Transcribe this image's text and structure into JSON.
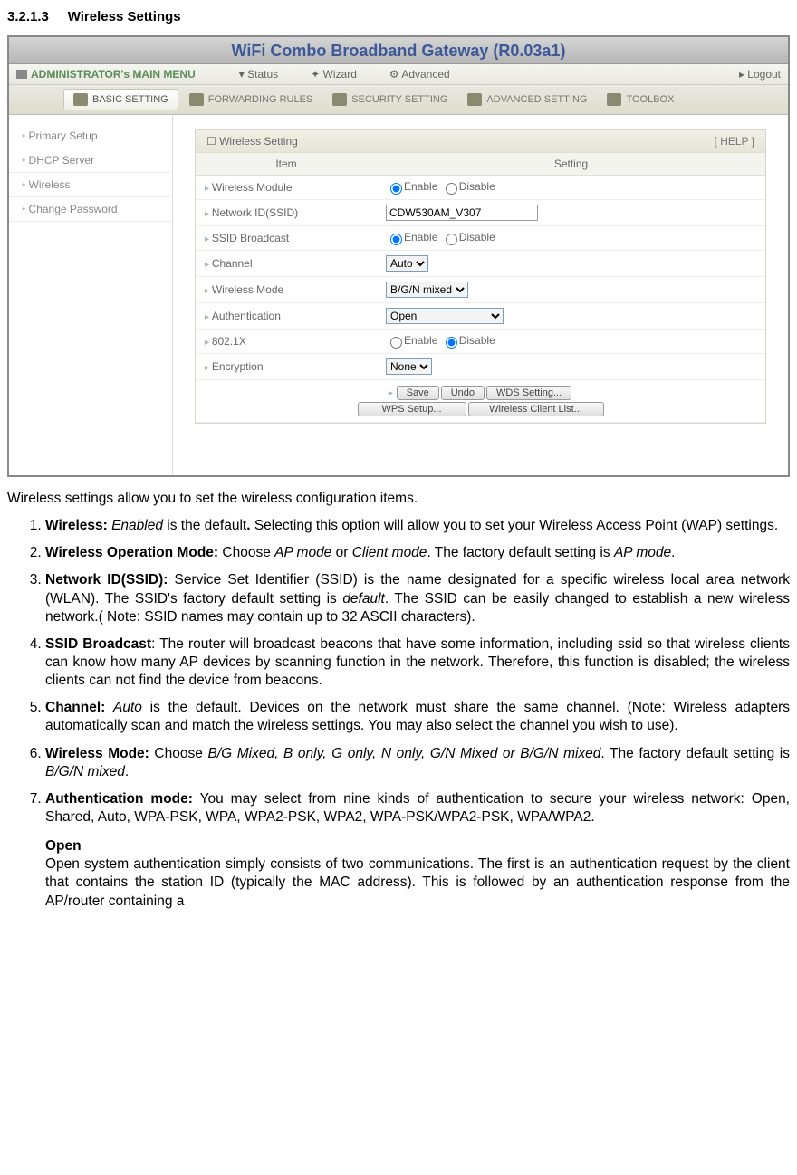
{
  "section_number": "3.2.1.3",
  "section_title": "Wireless Settings",
  "app": {
    "title": "WiFi Combo Broadband Gateway (R0.03a1)",
    "admin_label": "ADMINISTRATOR's MAIN MENU",
    "menu": {
      "status": "Status",
      "wizard": "Wizard",
      "advanced": "Advanced",
      "logout": "Logout"
    },
    "tabs": {
      "basic": "BASIC SETTING",
      "forwarding": "FORWARDING RULES",
      "security": "SECURITY SETTING",
      "advanced": "ADVANCED SETTING",
      "toolbox": "TOOLBOX"
    },
    "sidebar": {
      "primary": "Primary Setup",
      "dhcp": "DHCP Server",
      "wireless": "Wireless",
      "password": "Change Password"
    },
    "panel": {
      "title": "Wireless Setting",
      "help": "[ HELP ]",
      "col_item": "Item",
      "col_setting": "Setting",
      "rows": {
        "wmod": "Wireless Module",
        "ssid": "Network ID(SSID)",
        "bcast": "SSID Broadcast",
        "channel": "Channel",
        "wmode": "Wireless Mode",
        "auth": "Authentication",
        "dot1x": "802.1X",
        "enc": "Encryption"
      },
      "values": {
        "ssid": "CDW530AM_V307",
        "channel": "Auto",
        "wmode": "B/G/N mixed",
        "auth": "Open",
        "enc": "None",
        "enable": "Enable",
        "disable": "Disable"
      },
      "buttons": {
        "save": "Save",
        "undo": "Undo",
        "wds": "WDS Setting...",
        "wps": "WPS Setup...",
        "clients": "Wireless Client List..."
      }
    }
  },
  "doc": {
    "intro": "Wireless settings allow you to set the wireless configuration items.",
    "items": {
      "i1a": "Wireless:",
      "i1b": "Enabled",
      "i1c": " is the ",
      "i1d": "default",
      "i1e": ". ",
      "i1f": "Selecting this option will allow you to set your Wireless Access Point (WAP) settings.",
      "i2a": "Wireless Operation Mode:",
      "i2b": " Choose ",
      "i2c": "AP mode",
      "i2d": " or ",
      "i2e": "Client mode",
      "i2f": ". The factory default setting is ",
      "i2g": "AP mode",
      "i2h": ".",
      "i3a": "Network ID(SSID):",
      "i3b": " Service Set Identifier (SSID) is the name designated for a specific wireless local area network (WLAN). The SSID's factory default setting is ",
      "i3c": "default",
      "i3d": ". The SSID can be easily changed to establish a new wireless network.( Note: SSID names may contain up to 32 ASCII characters).",
      "i4a": "SSID Broadcast",
      "i4b": ": The router will broadcast beacons that have some information, including ssid so that wireless clients can know how many AP devices by scanning function in the network. Therefore, this function is disabled; the wireless clients can not find the device from beacons.",
      "i5a": "Channel:",
      "i5b": "Auto",
      "i5c": " is the ",
      "i5d": "default",
      "i5e": ". Devices on the network must share the same channel. (Note: Wireless adapters automatically scan and match the wireless settings. You may also select the channel you wish to use).",
      "i6a": "Wireless Mode:",
      "i6b": " Choose ",
      "i6c": "B/G Mixed, B only, G only, N only, G/N Mixed or B/G/N mixed",
      "i6d": ". The factory default setting is ",
      "i6e": "B/G/N mixed",
      "i6f": ".",
      "i7a": "Authentication mode:",
      "i7b": " You may select from nine kinds of authentication to secure your wireless network: Open, Shared, Auto, WPA-PSK, WPA, WPA2-PSK, WPA2, WPA-PSK/WPA2-PSK, WPA/WPA2.",
      "open_h": "Open",
      "open_b": "Open system authentication simply consists of two communications. The first is an authentication request by the client that contains the station ID (typically the MAC address). This is followed by an authentication response from the AP/router containing a"
    }
  }
}
